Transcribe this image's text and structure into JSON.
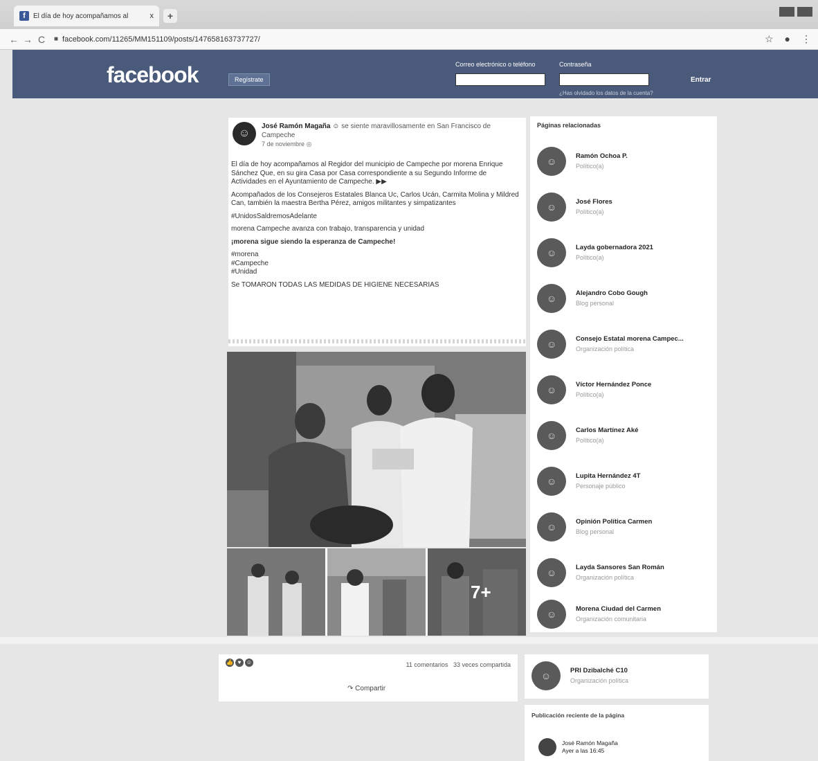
{
  "browser": {
    "tab_title": "El día de hoy acompañamos al",
    "tab_close": "x",
    "new_tab": "+",
    "url": "facebook.com/11265/MM151109/posts/147658163737727/",
    "back": "←",
    "forward": "→",
    "reload": "C",
    "star": "☆"
  },
  "header": {
    "logo": "facebook",
    "register_label": "Regístrate",
    "email_label": "Correo electrónico o teléfono",
    "password_label": "Contraseña",
    "forgot_label": "¿Has olvidado los datos de la cuenta?",
    "login_label": "Entrar"
  },
  "post": {
    "author": "José Ramón Magaña",
    "feeling": "se siente maravillosamente en San Francisco de Campeche",
    "date": "7 de noviembre",
    "p1": "El día de hoy acompañamos al Regidor del municipio de Campeche por morena Enrique Sánchez Que, en su gira Casa por Casa correspondiente a su Segundo Informe de Actividades en el Ayuntamiento de Campeche. ▶▶",
    "p2": "Acompañados de los Consejeros Estatales Blanca Uc, Carlos Ucán, Carmita Molina y Mildred Can, también la maestra Bertha Pérez, amigos militantes y simpatizantes",
    "p3": "#UnidosSaldremosAdelante",
    "p4": "morena Campeche avanza con trabajo, transparencia y unidad",
    "p5": "¡morena sigue siendo la esperanza de Campeche!",
    "tags": [
      "#morena",
      "#Campeche",
      "#Unidad"
    ],
    "p6": "Se TOMARON TODAS LAS MEDIDAS DE HIGIENE NECESARIAS",
    "more_photos": "7+",
    "comments": "11 comentarios",
    "shares": "33 veces compartida",
    "share_label": "Compartir"
  },
  "sidebar": {
    "title": "Páginas relacionadas",
    "items": [
      {
        "name": "Ramón Ochoa P.",
        "category": "Político(a)"
      },
      {
        "name": "José Flores",
        "category": "Político(a)"
      },
      {
        "name": "Layda gobernadora 2021",
        "category": "Político(a)"
      },
      {
        "name": "Alejandro Cobo Gough",
        "category": "Blog personal"
      },
      {
        "name": "Consejo Estatal morena Campec...",
        "category": "Organización política"
      },
      {
        "name": "Víctor Hernández Ponce",
        "category": "Político(a)"
      },
      {
        "name": "Carlos Martínez Aké",
        "category": "Político(a)"
      },
      {
        "name": "Lupita Hernández 4T",
        "category": "Personaje público"
      },
      {
        "name": "Opinión Política Carmen",
        "category": "Blog personal"
      },
      {
        "name": "Layda Sansores San Román",
        "category": "Organización política"
      },
      {
        "name": "Morena Ciudad del Carmen",
        "category": "Organización comunitaria"
      },
      {
        "name": "PRI Dzibalché C10",
        "category": "Organización política"
      }
    ],
    "recent_title": "Publicación reciente de la página",
    "recent_author": "José Ramón Magaña",
    "recent_time": "Ayer a las 16:45"
  }
}
